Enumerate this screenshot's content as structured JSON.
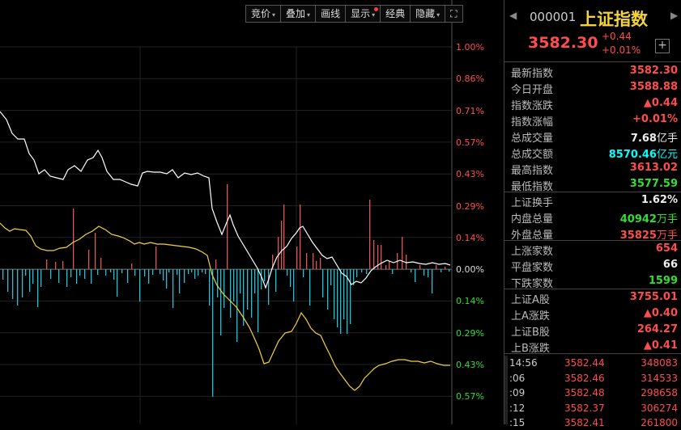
{
  "toolbar": [
    {
      "label": "竞价",
      "dropdown": true
    },
    {
      "label": "叠加",
      "dropdown": true
    },
    {
      "label": "画线",
      "dropdown": false
    },
    {
      "label": "显示",
      "dropdown": true,
      "dot": true
    },
    {
      "label": "经典",
      "dropdown": false
    },
    {
      "label": "隐藏",
      "dropdown": true
    }
  ],
  "expand_icon": "expand-icon",
  "y_axis_labels": [
    {
      "text": "1.00%",
      "color": "#ff4d4d"
    },
    {
      "text": "0.86%",
      "color": "#ff4d4d"
    },
    {
      "text": "0.71%",
      "color": "#ff4d4d"
    },
    {
      "text": "0.57%",
      "color": "#ff4d4d"
    },
    {
      "text": "0.43%",
      "color": "#ff4d4d"
    },
    {
      "text": "0.29%",
      "color": "#ff4d4d"
    },
    {
      "text": "0.14%",
      "color": "#ff4d4d"
    },
    {
      "text": "0.00%",
      "color": "#dddddd"
    },
    {
      "text": "0.14%",
      "color": "#33dd33"
    },
    {
      "text": "0.29%",
      "color": "#33dd33"
    },
    {
      "text": "0.43%",
      "color": "#33dd33"
    },
    {
      "text": "0.57%",
      "color": "#33dd33"
    }
  ],
  "header": {
    "prev": "◀",
    "next": "▶",
    "code": "000001",
    "name": "上证指数",
    "price": "3582.30",
    "change": "+0.44",
    "change_pct": "+0.01%"
  },
  "stats": [
    {
      "label": "最新指数",
      "value": "3582.30",
      "color": "#ff4d4d",
      "unit": ""
    },
    {
      "label": "今日开盘",
      "value": "3588.88",
      "color": "#ff4d4d",
      "unit": ""
    },
    {
      "label": "指数涨跌",
      "value": "▲0.44",
      "color": "#ff4d4d",
      "unit": ""
    },
    {
      "label": "指数涨幅",
      "value": "+0.01%",
      "color": "#ff4d4d",
      "unit": ""
    },
    {
      "label": "总成交量",
      "value": "7.68",
      "color": "#eeeeee",
      "unit": "亿手"
    },
    {
      "label": "总成交额",
      "value": "8570.46",
      "color": "#00ffff",
      "unit": "亿元"
    },
    {
      "label": "最高指数",
      "value": "3613.02",
      "color": "#ff4d4d",
      "unit": ""
    },
    {
      "label": "最低指数",
      "value": "3577.59",
      "color": "#33dd33",
      "unit": ""
    },
    {
      "label": "上证换手",
      "value": "1.62%",
      "color": "#eeeeee",
      "unit": ""
    },
    {
      "label": "内盘总量",
      "value": "40942",
      "color": "#33dd33",
      "unit": "万手"
    },
    {
      "label": "外盘总量",
      "value": "35825",
      "color": "#ff4d4d",
      "unit": "万手"
    },
    {
      "label": "上涨家数",
      "value": "654",
      "color": "#ff4d4d",
      "unit": ""
    },
    {
      "label": "平盘家数",
      "value": "66",
      "color": "#eeeeee",
      "unit": ""
    },
    {
      "label": "下跌家数",
      "value": "1599",
      "color": "#33dd33",
      "unit": ""
    },
    {
      "label": "上证A股",
      "value": "3755.01",
      "color": "#ff4d4d",
      "unit": ""
    },
    {
      "label": "上A涨跌",
      "value": "▲0.40",
      "color": "#ff4d4d",
      "unit": ""
    },
    {
      "label": "上证B股",
      "value": "264.27",
      "color": "#ff4d4d",
      "unit": ""
    },
    {
      "label": "上B涨跌",
      "value": "▲0.41",
      "color": "#ff4d4d",
      "unit": ""
    }
  ],
  "ticks": [
    {
      "time": "14:56",
      "price": "3582.44",
      "vol": "348083"
    },
    {
      "time": ":06",
      "price": "3582.46",
      "vol": "314533"
    },
    {
      "time": ":09",
      "price": "3582.48",
      "vol": "298658"
    },
    {
      "time": ":12",
      "price": "3582.37",
      "vol": "306274"
    },
    {
      "time": ":15",
      "price": "3582.41",
      "vol": "261800"
    }
  ],
  "colors": {
    "up": "#ff4d4d",
    "down": "#33dd33",
    "cyan": "#00ffff",
    "yellow": "#f4d23c",
    "line": "#ffffff"
  }
}
